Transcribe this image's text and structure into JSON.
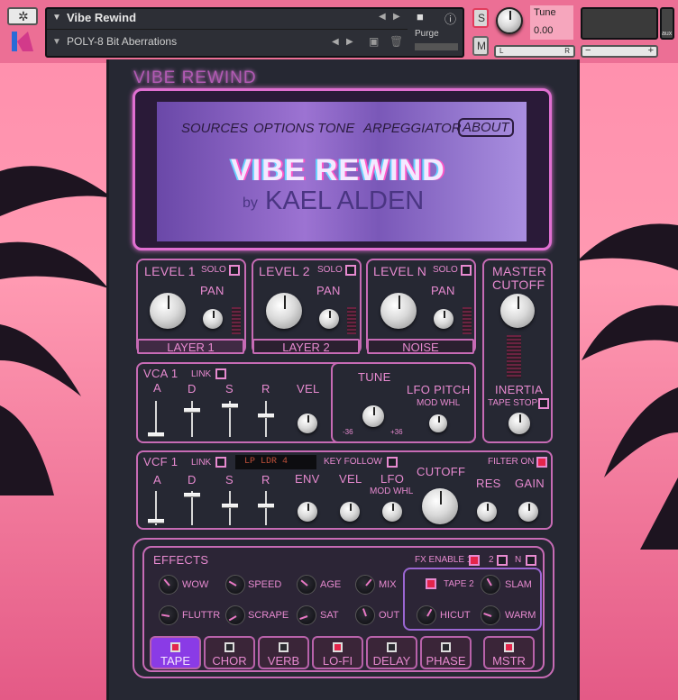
{
  "header": {
    "instrument_name": "Vibe Rewind",
    "preset_name": "POLY-8 Bit Aberrations",
    "purge_label": "Purge",
    "tune_label": "Tune",
    "tune_value": "0.00",
    "solo_label": "S",
    "mute_label": "M",
    "pan_left": "L",
    "pan_right": "R",
    "vol_minus": "−",
    "vol_plus": "+",
    "aux_label": "aux"
  },
  "panel": {
    "title": "VIBE REWIND",
    "tabs": [
      "SOURCES",
      "OPTIONS",
      "TONE",
      "ARPEGGIATOR",
      "ABOUT"
    ],
    "about_title": "VIBE REWIND",
    "about_by": "by",
    "about_author": "KAEL ALDEN"
  },
  "layers": [
    {
      "level": "LEVEL 1",
      "solo": "SOLO",
      "pan": "PAN",
      "name": "LAYER 1"
    },
    {
      "level": "LEVEL 2",
      "solo": "SOLO",
      "pan": "PAN",
      "name": "LAYER 2"
    },
    {
      "level": "LEVEL N",
      "solo": "SOLO",
      "pan": "PAN",
      "name": "NOISE"
    }
  ],
  "master": {
    "title_1": "MASTER",
    "title_2": "CUTOFF",
    "inertia": "INERTIA",
    "tape_stop": "TAPE STOP"
  },
  "vca": {
    "title": "VCA 1",
    "link": "LINK",
    "adsr": [
      "A",
      "D",
      "S",
      "R"
    ],
    "vel": "VEL",
    "tune": "TUNE",
    "tune_min": "-36",
    "tune_max": "+36",
    "lfo_pitch": "LFO PITCH",
    "mod_whl": "MOD WHL"
  },
  "vcf": {
    "title": "VCF 1",
    "link": "LINK",
    "mode": "LP LDR 4",
    "key_follow": "KEY FOLLOW",
    "filter_on": "FILTER ON",
    "adsr": [
      "A",
      "D",
      "S",
      "R"
    ],
    "env": "ENV",
    "vel": "VEL",
    "lfo": "LFO",
    "mod_whl": "MOD WHL",
    "cutoff": "CUTOFF",
    "res": "RES",
    "gain": "GAIN"
  },
  "effects": {
    "title": "EFFECTS",
    "fx_enable": "FX ENABLE 1",
    "fx2": "2",
    "fxn": "N",
    "knobs": [
      "WOW",
      "SPEED",
      "AGE",
      "MIX",
      "FLUTTR",
      "SCRAPE",
      "SAT",
      "OUT"
    ],
    "tape2": "TAPE 2",
    "slam": "SLAM",
    "hicut": "HICUT",
    "warm": "WARM",
    "tabs": [
      "TAPE",
      "CHOR",
      "VERB",
      "LO-FI",
      "DELAY",
      "PHASE",
      "MSTR"
    ]
  },
  "colors": {
    "accent": "#e78ad0",
    "panel": "#262833",
    "led_on": "#e3254b",
    "active_tab": "#8a3be6"
  }
}
